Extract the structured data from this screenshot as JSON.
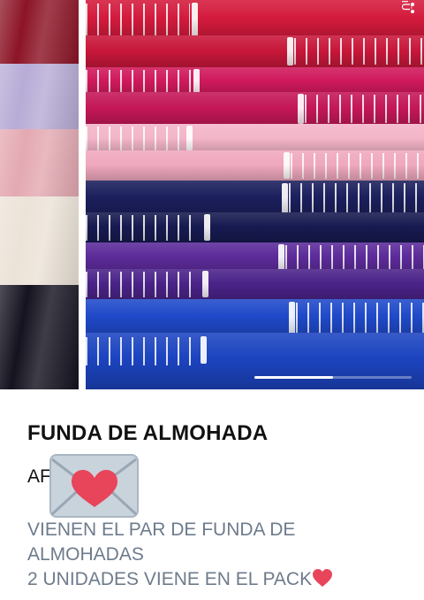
{
  "product": {
    "title": "FUNDA DE ALMOHADA",
    "code_visible": "AF",
    "description": {
      "line1": "VIENEN EL PAR DE FUNDA DE",
      "line2": "ALMOHADAS",
      "line3": "2 UNIDADES VIENE EN EL PACK"
    }
  },
  "photo": {
    "brand_mark": "ıÜ",
    "overflow_icon": "overflow-menu-icon",
    "gallery_progress": 0.5
  },
  "icons": {
    "mail_heart": "love-letter-icon",
    "heart": "red-heart-icon"
  },
  "colors": {
    "title": "#111111",
    "description": "#6e7b8c",
    "heart": "#e8455a"
  }
}
